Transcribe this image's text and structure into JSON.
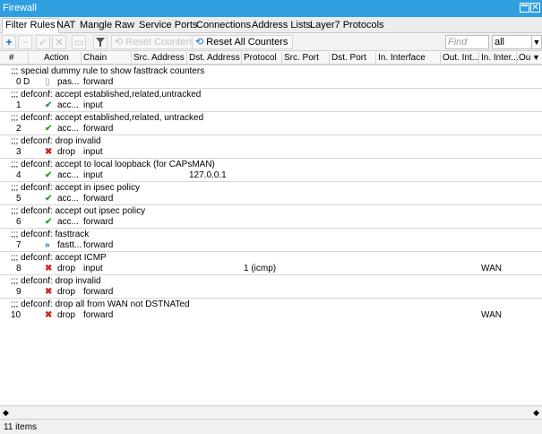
{
  "window": {
    "title": "Firewall"
  },
  "tabs": [
    "Filter Rules",
    "NAT",
    "Mangle",
    "Raw",
    "Service Ports",
    "Connections",
    "Address Lists",
    "Layer7 Protocols"
  ],
  "toolbar": {
    "reset_counters": "Reset Counters",
    "reset_all_counters": "Reset All Counters",
    "search_placeholder": "Find",
    "filter_value": "all"
  },
  "columns": [
    "#",
    "Action",
    "Chain",
    "Src. Address",
    "Dst. Address",
    "Protocol",
    "Src. Port",
    "Dst. Port",
    "In. Interface",
    "Out. Int...",
    "In. Inter...",
    "Ou"
  ],
  "rows": [
    {
      "comment": ";;; special dummy rule to show fasttrack counters"
    },
    {
      "num": "0",
      "flag": "D",
      "action": "pas...",
      "action_icon": "passthrough-icon",
      "chain": "forward",
      "src": "",
      "dst": "",
      "proto": "",
      "in_iface_list": ""
    },
    {
      "comment": ";;; defconf: accept established,related,untracked"
    },
    {
      "num": "1",
      "flag": "",
      "action": "acc...",
      "action_icon": "accept-check-icon",
      "chain": "input",
      "src": "",
      "dst": "",
      "proto": "",
      "in_iface_list": ""
    },
    {
      "comment": ";;; defconf: accept established,related, untracked"
    },
    {
      "num": "2",
      "flag": "",
      "action": "acc...",
      "action_icon": "accept-check-icon",
      "chain": "forward",
      "src": "",
      "dst": "",
      "proto": "",
      "in_iface_list": ""
    },
    {
      "comment": ";;; defconf: drop invalid"
    },
    {
      "num": "3",
      "flag": "",
      "action": "drop",
      "action_icon": "drop-x-icon",
      "chain": "input",
      "src": "",
      "dst": "",
      "proto": "",
      "in_iface_list": ""
    },
    {
      "comment": ";;; defconf: accept to local loopback (for CAPsMAN)"
    },
    {
      "num": "4",
      "flag": "",
      "action": "acc...",
      "action_icon": "accept-check-icon",
      "chain": "input",
      "src": "",
      "dst": "127.0.0.1",
      "proto": "",
      "in_iface_list": ""
    },
    {
      "comment": ";;; defconf: accept in ipsec policy"
    },
    {
      "num": "5",
      "flag": "",
      "action": "acc...",
      "action_icon": "accept-check-icon",
      "chain": "forward",
      "src": "",
      "dst": "",
      "proto": "",
      "in_iface_list": ""
    },
    {
      "comment": ";;; defconf: accept out ipsec policy"
    },
    {
      "num": "6",
      "flag": "",
      "action": "acc...",
      "action_icon": "accept-check-icon",
      "chain": "forward",
      "src": "",
      "dst": "",
      "proto": "",
      "in_iface_list": ""
    },
    {
      "comment": ";;; defconf: fasttrack"
    },
    {
      "num": "7",
      "flag": "",
      "action": "fastt...",
      "action_icon": "fasttrack-icon",
      "chain": "forward",
      "src": "",
      "dst": "",
      "proto": "",
      "in_iface_list": ""
    },
    {
      "comment": ";;; defconf: accept ICMP"
    },
    {
      "num": "8",
      "flag": "",
      "action": "drop",
      "action_icon": "drop-x-icon",
      "chain": "input",
      "src": "",
      "dst": "",
      "proto": "1 (icmp)",
      "in_iface_list": "WAN"
    },
    {
      "comment": ";;; defconf: drop invalid"
    },
    {
      "num": "9",
      "flag": "",
      "action": "drop",
      "action_icon": "drop-x-icon",
      "chain": "forward",
      "src": "",
      "dst": "",
      "proto": "",
      "in_iface_list": ""
    },
    {
      "comment": ";;; defconf: drop all from WAN not DSTNATed"
    },
    {
      "num": "10",
      "flag": "",
      "action": "drop",
      "action_icon": "drop-x-icon",
      "chain": "forward",
      "src": "",
      "dst": "",
      "proto": "",
      "in_iface_list": "WAN"
    }
  ],
  "status": {
    "items": "11 items"
  },
  "colors": {
    "titlebar": "#2f9fe0",
    "accept": "#2aa534",
    "drop": "#d0281f",
    "add": "#1570c8"
  }
}
